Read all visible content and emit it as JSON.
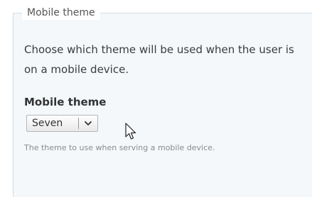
{
  "fieldset": {
    "legend": "Mobile theme",
    "description": "Choose which theme will be used when the user is on a mobile device."
  },
  "mobile_theme_field": {
    "label": "Mobile theme",
    "selected_value": "Seven",
    "help_text": "The theme to use when serving a mobile device."
  },
  "icons": {
    "dropdown": "chevron-down-icon",
    "pointer": "mouse-pointer-icon"
  }
}
